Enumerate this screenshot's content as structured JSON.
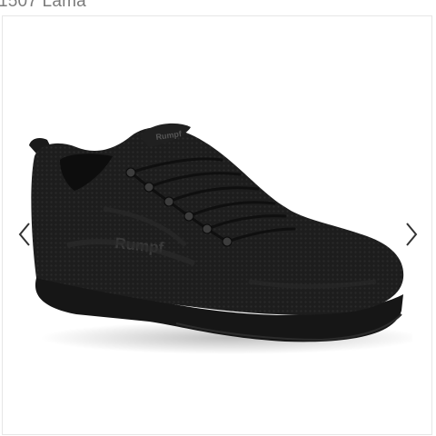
{
  "product": {
    "title": "1507 Lama",
    "image": {
      "description_icon": "black-knit-sneaker-image",
      "brand_print": "Rumpf"
    }
  },
  "gallery": {
    "prev_icon": "chevron-left-icon",
    "next_icon": "chevron-right-icon"
  },
  "colors": {
    "shoe": "#1c1c1c",
    "sole": "#151515",
    "arrow": "#333333",
    "border": "#e6e6e6",
    "title": "#7b7b7b"
  }
}
